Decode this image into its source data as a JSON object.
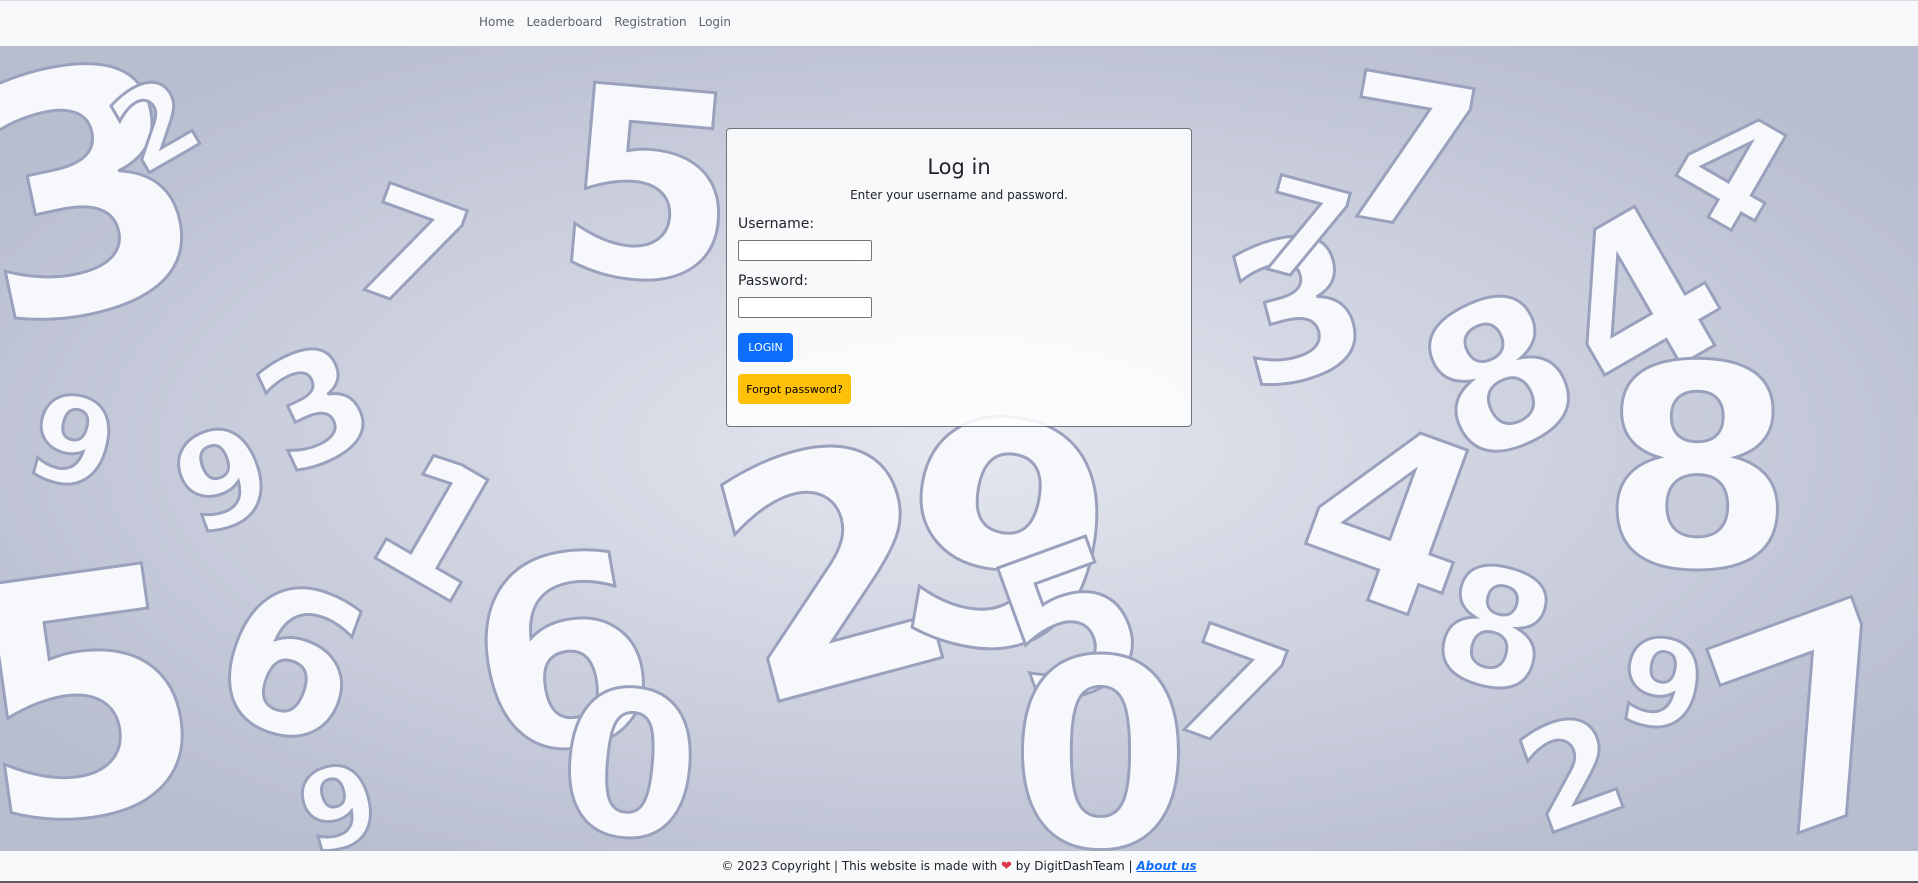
{
  "nav": {
    "items": [
      "Home",
      "Leaderboard",
      "Registration",
      "Login"
    ]
  },
  "login_card": {
    "title": "Log in",
    "subtitle": "Enter your username and password.",
    "username_label": "Username:",
    "username_value": "",
    "password_label": "Password:",
    "password_value": "",
    "login_button": "LOGIN",
    "forgot_button": "Forgot password?"
  },
  "footer": {
    "copyright_text": "© 2023 Copyright | This website is made with",
    "heart_icon": "heart-icon",
    "team_text": "by DigitDashTeam |",
    "about_link": "About us"
  },
  "colors": {
    "primary": "#0d6efd",
    "warning": "#ffc107",
    "background_bluegray": "#c6cad9",
    "heart": "#dc3545"
  }
}
